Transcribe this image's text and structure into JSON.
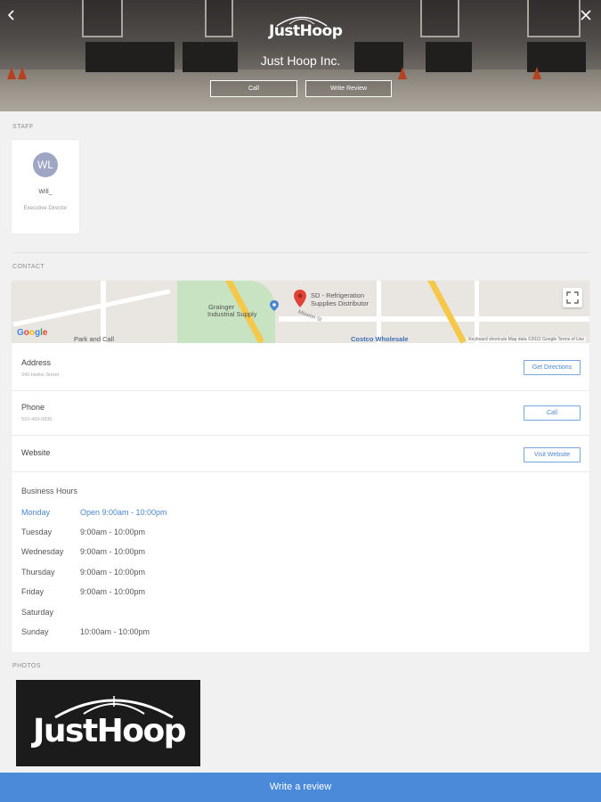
{
  "header": {
    "logo_text": "JustHoop",
    "business_name": "Just Hoop Inc.",
    "call_label": "Call",
    "write_review_label": "Write Review",
    "back_icon": "chevron-left-icon",
    "close_icon": "close-icon"
  },
  "staff": {
    "section_label": "STAFF",
    "members": [
      {
        "initials": "WL",
        "name": "Will_",
        "role": "Executive Director"
      }
    ]
  },
  "contact": {
    "section_label": "CONTACT",
    "map": {
      "place_label_1": "SD - Refrigeration",
      "place_label_2": "Supplies Distributor",
      "label_grainger_1": "Grainger",
      "label_grainger_2": "Industrial Supply",
      "label_park": "Park and Call",
      "label_costco": "Costco Wholesale",
      "label_street": "Mission St",
      "label_google": "Google",
      "attribution": "Keyboard shortcuts   Map data ©2022 Google   Terms of Use"
    },
    "address": {
      "label": "Address",
      "value": "340 Heikin Street",
      "button": "Get Directions"
    },
    "phone": {
      "label": "Phone",
      "value": "510-469-0830",
      "button": "Call"
    },
    "website": {
      "label": "Website",
      "button": "Visit Website"
    },
    "hours": {
      "title": "Business Hours",
      "rows": [
        {
          "day": "Monday",
          "time": "Open 9:00am - 10:00pm",
          "today": true
        },
        {
          "day": "Tuesday",
          "time": "9:00am - 10:00pm"
        },
        {
          "day": "Wednesday",
          "time": "9:00am - 10:00pm"
        },
        {
          "day": "Thursday",
          "time": "9:00am - 10:00pm"
        },
        {
          "day": "Friday",
          "time": "9:00am - 10:00pm"
        },
        {
          "day": "Saturday",
          "time": ""
        },
        {
          "day": "Sunday",
          "time": "10:00am - 10:00pm"
        }
      ]
    }
  },
  "photos": {
    "section_label": "PHOTOS",
    "logo_text": "JustHoop"
  },
  "bottom_bar": {
    "label": "Write a review"
  },
  "colors": {
    "accent": "#4a8ad8",
    "today": "#4a86d0",
    "avatar": "#9ea6c3"
  }
}
